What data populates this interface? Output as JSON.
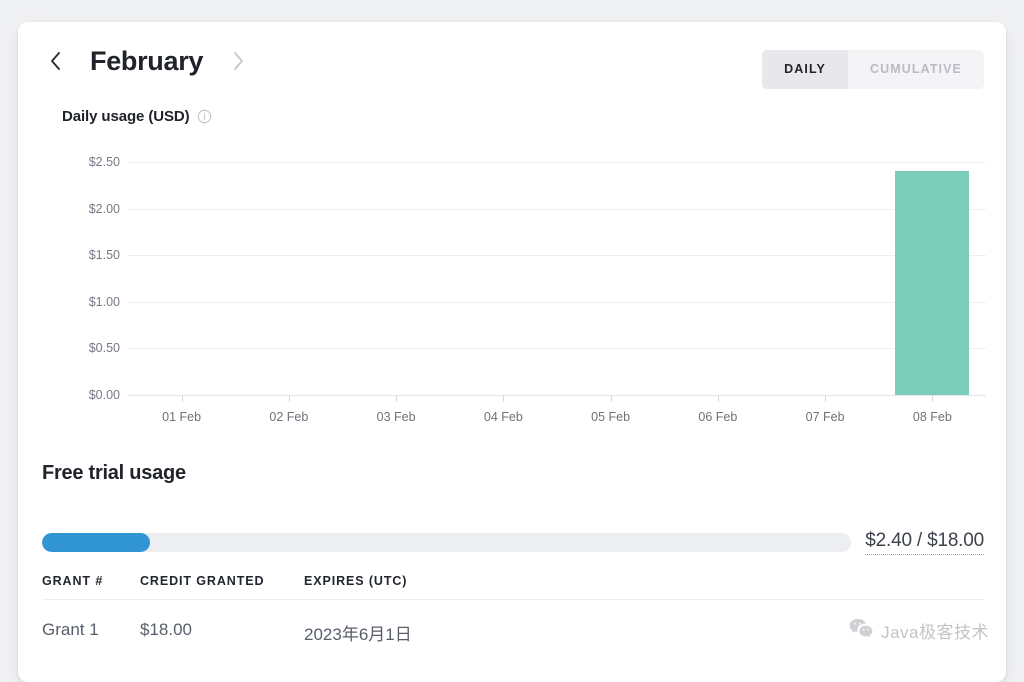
{
  "header": {
    "prev_icon": "chevron-left-icon",
    "month": "February",
    "next_icon": "chevron-right-icon",
    "toggle": {
      "daily": "DAILY",
      "cumulative": "CUMULATIVE",
      "selected": "DAILY"
    }
  },
  "chart_section": {
    "title": "Daily usage (USD)",
    "info_icon": "info-circle-icon"
  },
  "chart_data": {
    "type": "bar",
    "title": "Daily usage (USD)",
    "xlabel": "",
    "ylabel": "",
    "categories": [
      "01 Feb",
      "02 Feb",
      "03 Feb",
      "04 Feb",
      "05 Feb",
      "06 Feb",
      "07 Feb",
      "08 Feb"
    ],
    "values": [
      0,
      0,
      0,
      0,
      0,
      0,
      0,
      2.4
    ],
    "ylim": [
      0,
      2.5
    ],
    "ytick_labels": [
      "$2.50",
      "$2.00",
      "$1.50",
      "$1.00",
      "$0.50",
      "$0.00"
    ],
    "ytick_values": [
      2.5,
      2.0,
      1.5,
      1.0,
      0.5,
      0.0
    ],
    "grid": true,
    "legend": false,
    "bar_color": "#7bcdb9"
  },
  "trial": {
    "title": "Free trial usage",
    "used": "$2.40",
    "total": "$18.00",
    "amount_label": "$2.40 / $18.00",
    "percent": 13.3,
    "fill_color": "#3295d3",
    "track_color": "#edeef1"
  },
  "grants": {
    "columns": [
      "GRANT #",
      "CREDIT GRANTED",
      "EXPIRES (UTC)"
    ],
    "rows": [
      {
        "grant": "Grant 1",
        "credit": "$18.00",
        "expires": "2023年6月1日"
      }
    ]
  },
  "watermark": {
    "icon": "wechat-icon",
    "text": "Java极客技术"
  }
}
